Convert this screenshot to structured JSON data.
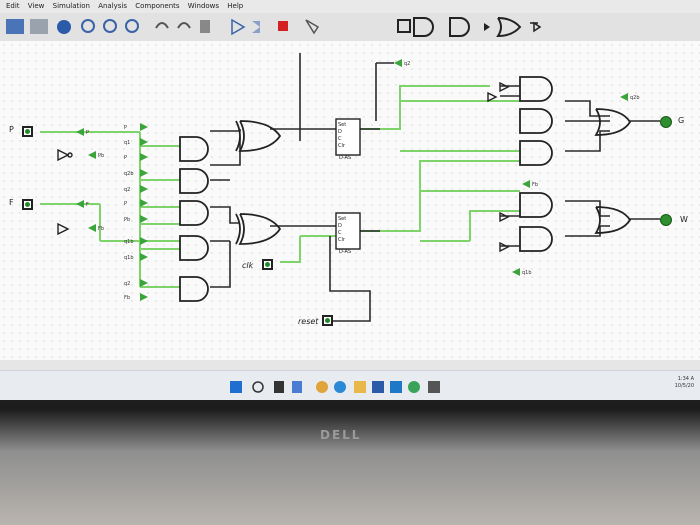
{
  "menubar": {
    "items": [
      "Edit",
      "View",
      "Simulation",
      "Analysis",
      "Components",
      "Windows",
      "Help"
    ]
  },
  "pins": {
    "p": "P",
    "f": "F",
    "clk": "clk",
    "reset": "reset"
  },
  "outputs": {
    "g": "G",
    "w": "W"
  },
  "tunnels": {
    "top": "q2",
    "fb": "Fb",
    "q1b": "q1b",
    "q2b": "q2b",
    "p": "P",
    "f": "F",
    "pb": "Pb"
  },
  "flipflops": {
    "label": "D-AS",
    "ports": [
      "Set",
      "D",
      "C",
      "Clr"
    ],
    "q": "Q"
  },
  "input_labels": [
    "P",
    "q1",
    "P",
    "q2b",
    "q2",
    "P",
    "Pb",
    "q1b",
    "q1b",
    "q2",
    "Fb"
  ],
  "brand": "DELL",
  "clock": {
    "time": "1:34 A",
    "date": "10/5/20"
  }
}
